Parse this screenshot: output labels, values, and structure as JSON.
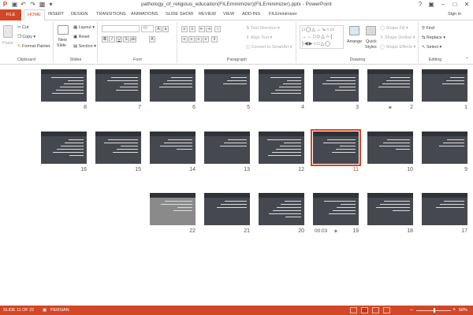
{
  "window": {
    "title": "pathology_of_religious_education(FILEminimizer)(FILEminimizer).pptx - PowerPoint",
    "quick_access": [
      "save-icon",
      "undo-icon",
      "redo-icon",
      "present-icon",
      "customize-icon"
    ]
  },
  "tabs": [
    {
      "label": "FILE"
    },
    {
      "label": "HOME"
    },
    {
      "label": "INSERT"
    },
    {
      "label": "DESIGN"
    },
    {
      "label": "TRANSITIONS"
    },
    {
      "label": "ANIMATIONS"
    },
    {
      "label": "SLIDE SHOW"
    },
    {
      "label": "REVIEW"
    },
    {
      "label": "VIEW"
    },
    {
      "label": "ADD-INS"
    },
    {
      "label": "FILEminimizer"
    }
  ],
  "signin": "Sign in",
  "ribbon": {
    "clipboard": {
      "paste": "Paste",
      "cut": "Cut",
      "copy": "Copy",
      "format_painter": "Format Painter",
      "label": "Clipboard"
    },
    "slides": {
      "new_slide": "New",
      "new_slide2": "Slide",
      "layout": "Layout",
      "reset": "Reset",
      "section": "Section",
      "label": "Slides"
    },
    "font": {
      "size": "48",
      "label": "Font"
    },
    "paragraph": {
      "text_direction": "Text Direction",
      "align_text": "Align Text",
      "convert": "Convert to SmartArt",
      "label": "Paragraph"
    },
    "drawing": {
      "arrange": "Arrange",
      "quick_styles": "Quick",
      "quick_styles2": "Styles",
      "shape_fill": "Shape Fill",
      "shape_outline": "Shape Outline",
      "shape_effects": "Shape Effects",
      "label": "Drawing"
    },
    "editing": {
      "find": "Find",
      "replace": "Replace",
      "select": "Select",
      "label": "Editing"
    }
  },
  "slides": [
    {
      "number": "1",
      "row": 0
    },
    {
      "number": "2",
      "row": 0,
      "star": true
    },
    {
      "number": "3",
      "row": 0
    },
    {
      "number": "4",
      "row": 0
    },
    {
      "number": "5",
      "row": 0
    },
    {
      "number": "6",
      "row": 0
    },
    {
      "number": "7",
      "row": 0
    },
    {
      "number": "8",
      "row": 0
    },
    {
      "number": "9",
      "row": 1
    },
    {
      "number": "10",
      "row": 1
    },
    {
      "number": "11",
      "row": 1,
      "selected": true
    },
    {
      "number": "12",
      "row": 1
    },
    {
      "number": "13",
      "row": 1
    },
    {
      "number": "14",
      "row": 1
    },
    {
      "number": "15",
      "row": 1
    },
    {
      "number": "16",
      "row": 1
    },
    {
      "number": "17",
      "row": 2
    },
    {
      "number": "18",
      "row": 2
    },
    {
      "number": "19",
      "row": 2,
      "star": true,
      "timing": "00:03"
    },
    {
      "number": "20",
      "row": 2
    },
    {
      "number": "21",
      "row": 2
    },
    {
      "number": "22",
      "row": 2
    }
  ],
  "status": {
    "slide": "SLIDE 11 OF 22",
    "language": "PERSIAN",
    "zoom": "58%",
    "zoom_level": 0.58
  },
  "colors": {
    "accent": "#d24726"
  }
}
